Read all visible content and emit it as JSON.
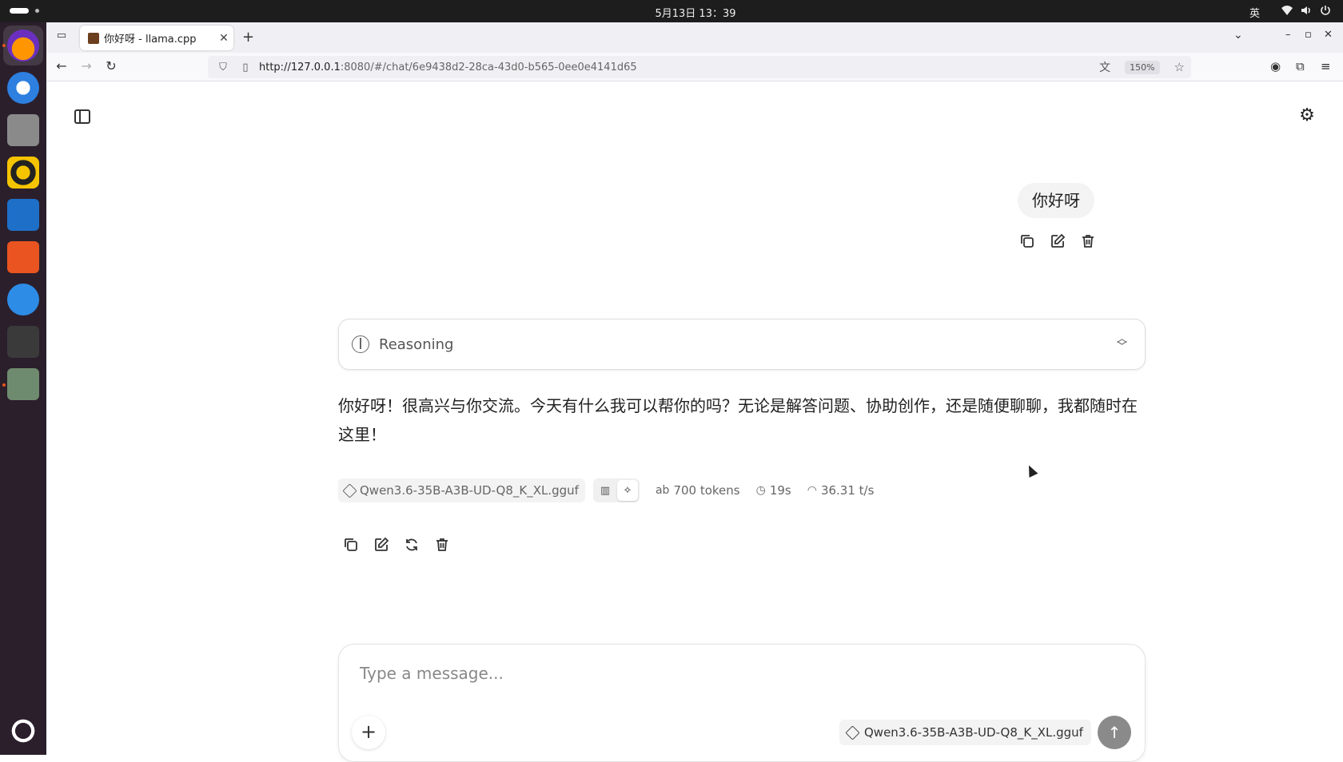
{
  "system_bar": {
    "clock": "5月13日 13：39",
    "ime": "英"
  },
  "browser": {
    "tab_title": "你好呀 - llama.cpp",
    "url_host": "http://127.0.0.1",
    "url_rest": ":8080/#/chat/6e9438d2-28ca-43d0-b565-0ee0e4141d65",
    "zoom": "150%"
  },
  "chat": {
    "user_message": "你好呀",
    "reasoning_label": "Reasoning",
    "assistant_message": "你好呀！很高兴与你交流。今天有什么我可以帮你的吗？无论是解答问题、协助创作，还是随便聊聊，我都随时在这里！",
    "meta": {
      "model": "Qwen3.6-35B-A3B-UD-Q8_K_XL.gguf",
      "tokens": "700 tokens",
      "time": "19s",
      "speed": "36.31 t/s"
    }
  },
  "composer": {
    "placeholder": "Type a message...",
    "model": "Qwen3.6-35B-A3B-UD-Q8_K_XL.gguf"
  },
  "icons": {
    "copy": "copy-icon",
    "edit": "edit-icon",
    "delete": "trash-icon",
    "regenerate": "refresh-icon",
    "settings": "gear-icon"
  }
}
